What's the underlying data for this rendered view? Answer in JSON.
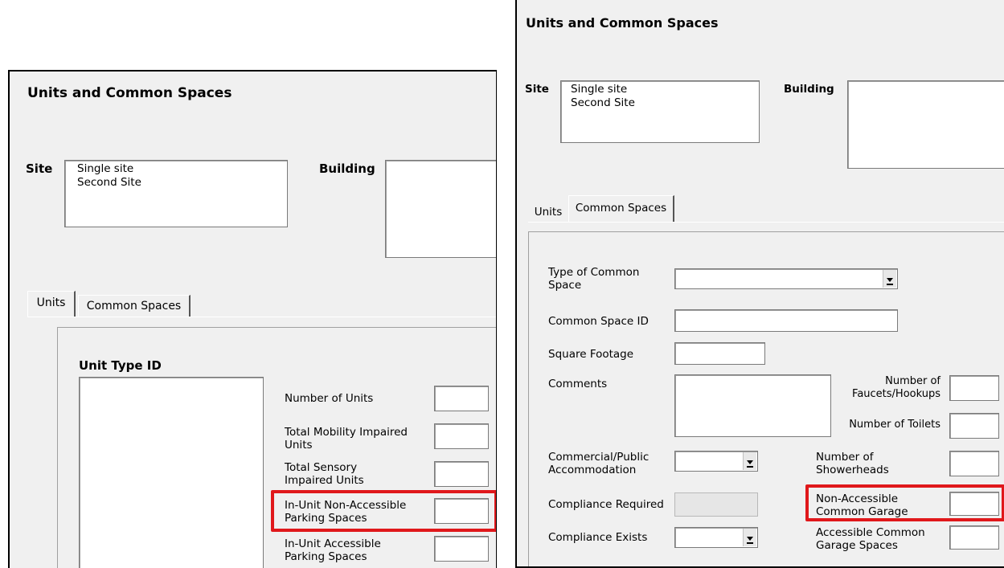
{
  "left": {
    "title": "Units and Common Spaces",
    "site_label": "Site",
    "site_items": [
      "Single site",
      "Second Site"
    ],
    "building_label": "Building",
    "tabs": [
      "Units",
      "Common Spaces"
    ],
    "unit_type_label": "Unit Type ID",
    "fields": [
      "Number of Units",
      "Total Mobility Impaired Units",
      "Total Sensory Impaired Units",
      "In-Unit Non-Accessible Parking Spaces",
      "In-Unit Accessible Parking Spaces"
    ],
    "highlight_color": "#e0181b"
  },
  "right": {
    "title": "Units and Common Spaces",
    "site_label": "Site",
    "site_items": [
      "Single site",
      "Second Site"
    ],
    "building_label": "Building",
    "tabs": [
      "Units",
      "Common Spaces"
    ],
    "type_label": "Type of Common Space",
    "id_label": "Common Space ID",
    "sqft_label": "Square Footage",
    "comments_label": "Comments",
    "faucets_label": "Number of Faucets/Hookups",
    "toilets_label": "Number of Toilets",
    "commercial_label": "Commercial/Public Accommodation",
    "showerheads_label": "Number of Showerheads",
    "compliance_required_label": "Compliance Required",
    "non_accessible_garage_label": "Non-Accessible Common Garage",
    "compliance_exists_label": "Compliance Exists",
    "accessible_garage_label": "Accessible Common Garage Spaces",
    "highlight_color": "#e0181b"
  }
}
